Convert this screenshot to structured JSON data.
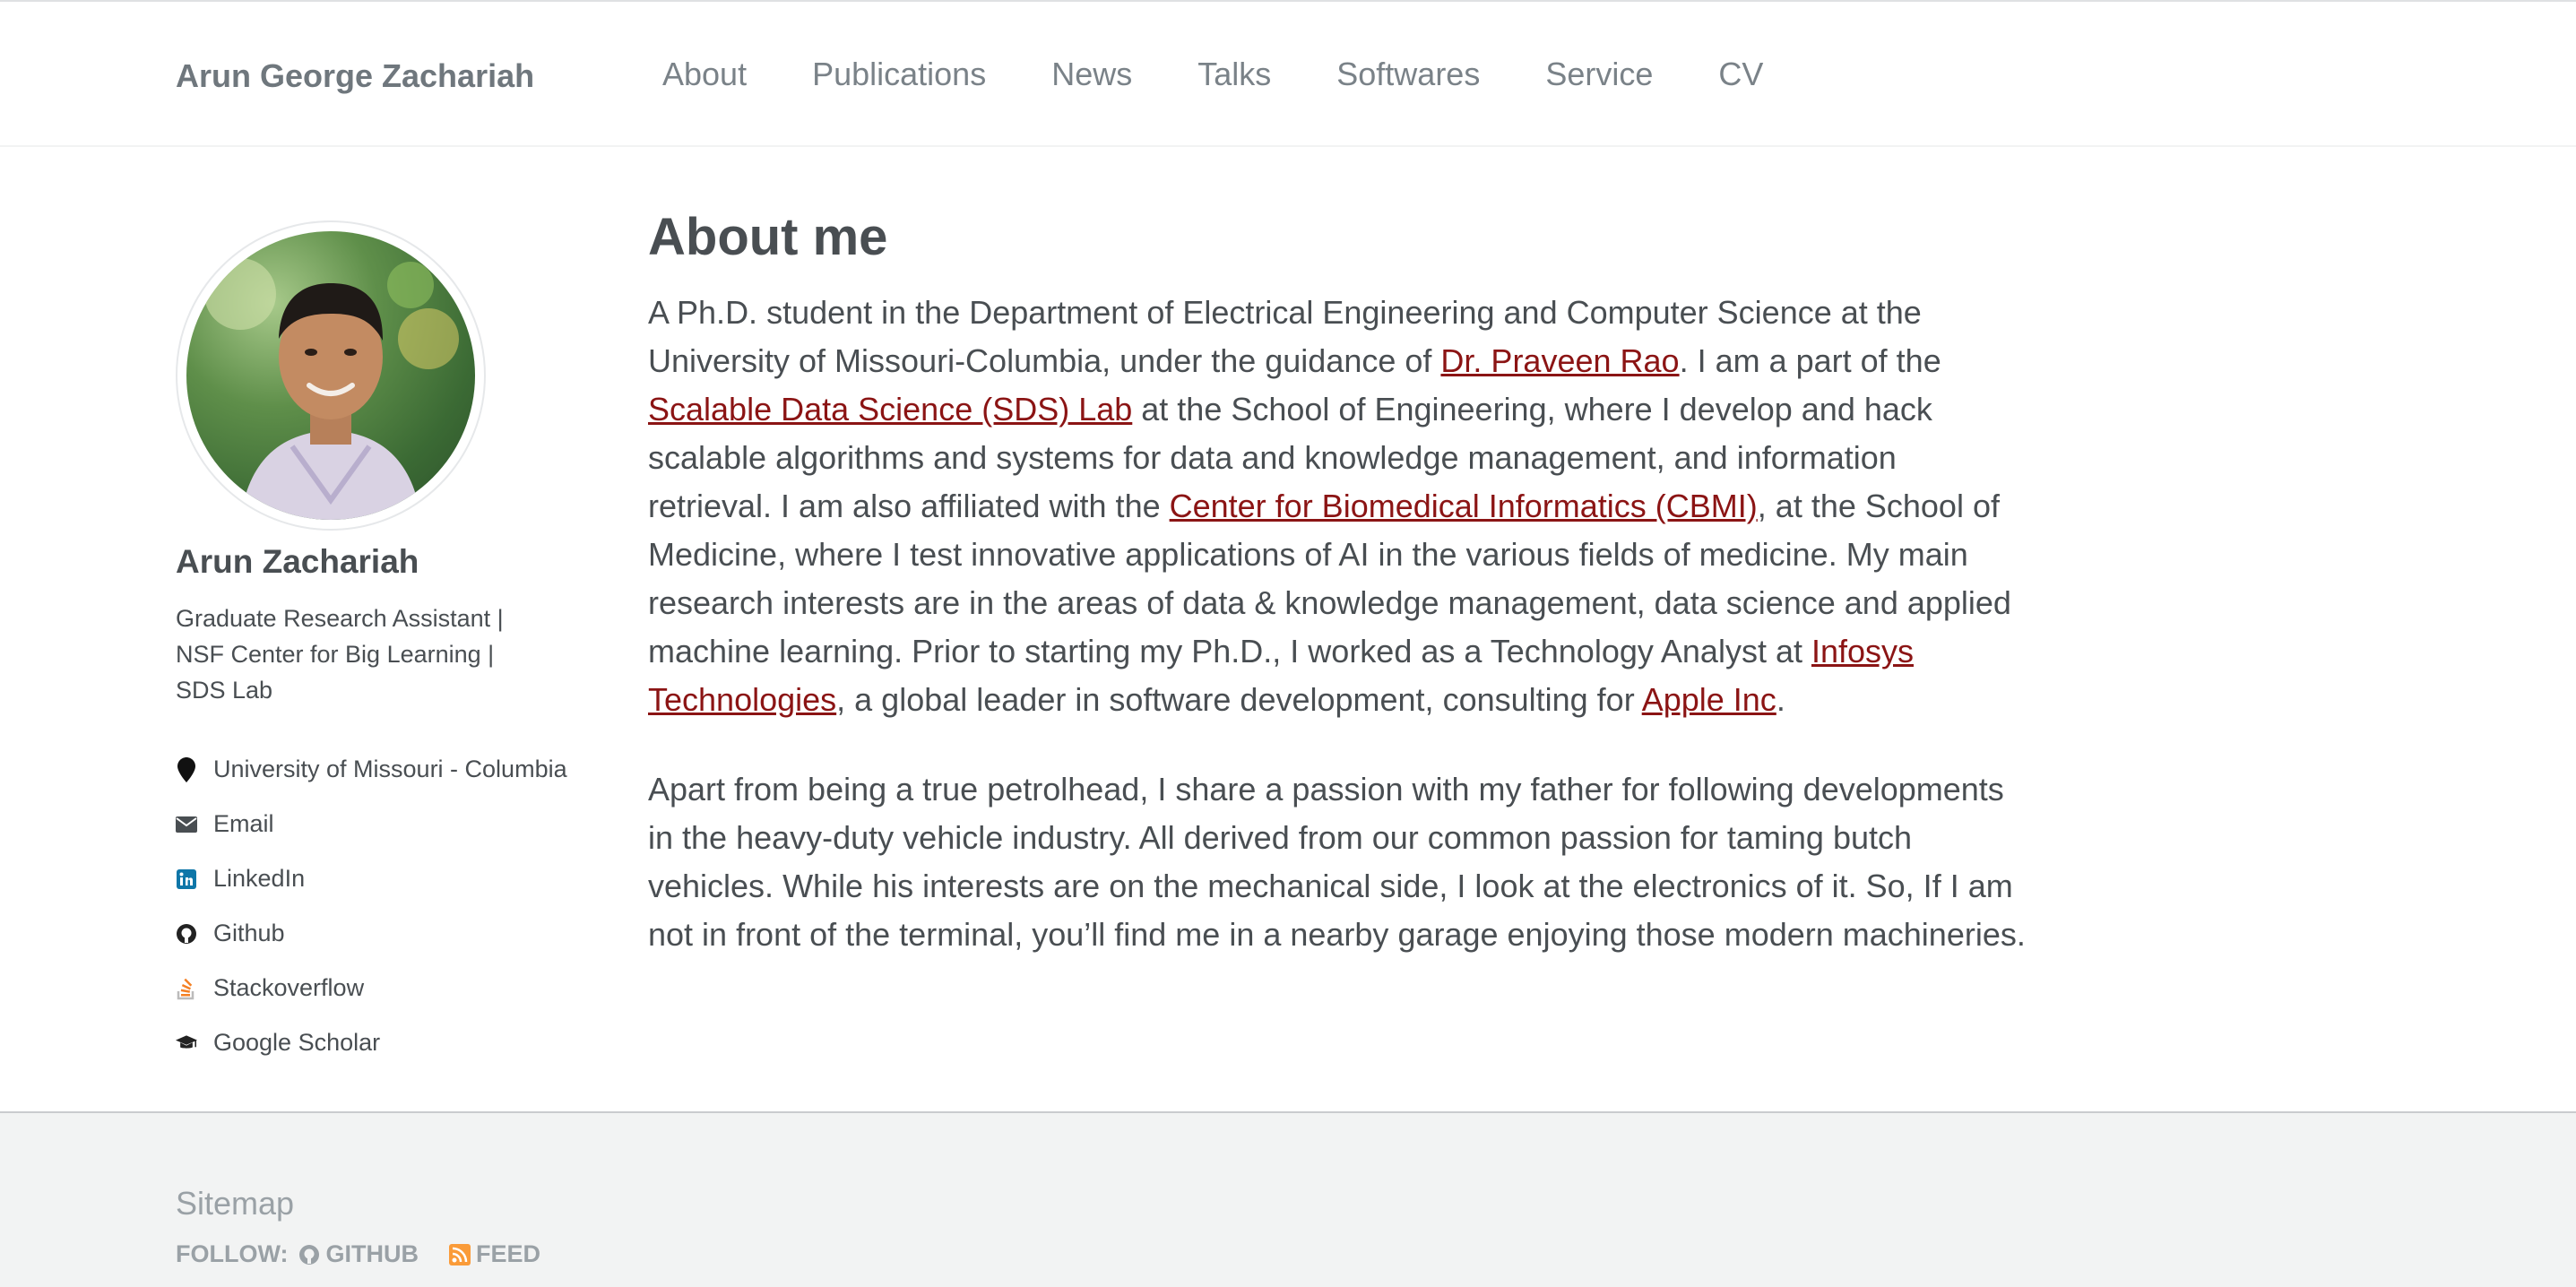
{
  "masthead": {
    "site_title": "Arun George Zachariah",
    "nav": [
      "About",
      "Publications",
      "News",
      "Talks",
      "Softwares",
      "Service",
      "CV"
    ]
  },
  "sidebar": {
    "name": "Arun Zachariah",
    "bio_lines": [
      "Graduate Research Assistant |",
      "NSF Center for Big Learning |",
      "SDS Lab"
    ],
    "links": [
      {
        "label": "University of Missouri - Columbia",
        "icon": "map-marker-icon"
      },
      {
        "label": "Email",
        "icon": "envelope-icon"
      },
      {
        "label": "LinkedIn",
        "icon": "linkedin-icon"
      },
      {
        "label": "Github",
        "icon": "github-icon"
      },
      {
        "label": "Stackoverflow",
        "icon": "stackoverflow-icon"
      },
      {
        "label": "Google Scholar",
        "icon": "graduation-cap-icon"
      }
    ]
  },
  "content": {
    "title": "About me",
    "p1": {
      "t1": "A Ph.D. student in the Department of Electrical Engineering and Computer Science at the University of Missouri-Columbia, under the guidance of ",
      "l1": "Dr. Praveen Rao",
      "t2": ". I am a part of the ",
      "l2": "Scalable Data Science (SDS) Lab",
      "t3": " at the School of Engineering, where I develop and hack scalable algorithms and systems for data and knowledge management, and information retrieval. I am also affiliated with the ",
      "l3": "Center for Biomedical Informatics (CBMI)",
      "t4": ", at the School of Medicine, where I test innovative applications of AI in the various fields of medicine. My main research interests are in the areas of data & knowledge management, data science and applied machine learning. Prior to starting my Ph.D., I worked as a Technology Analyst at ",
      "l4": "Infosys Technologies",
      "t5": ", a global leader in software development, consulting for ",
      "l5": "Apple Inc",
      "t6": "."
    },
    "p2": "Apart from being a true petrolhead, I share a passion with my father for following developments in the heavy-duty vehicle industry. All derived from our common passion for taming butch vehicles. While his interests are on the mechanical side, I look at the electronics of it. So, If I am not in front of the terminal, you’ll find me in a nearby garage enjoying those modern machineries."
  },
  "footer": {
    "sitemap": "Sitemap",
    "follow_label": "FOLLOW:",
    "github": "GITHUB",
    "feed": "FEED"
  },
  "colors": {
    "link": "#8b1414",
    "text": "#494e52",
    "nav": "#7a8288",
    "footer_bg": "#f2f3f3",
    "linkedin": "#0e76a8",
    "stackoverflow": "#f48024",
    "feed": "#fa9b39"
  }
}
